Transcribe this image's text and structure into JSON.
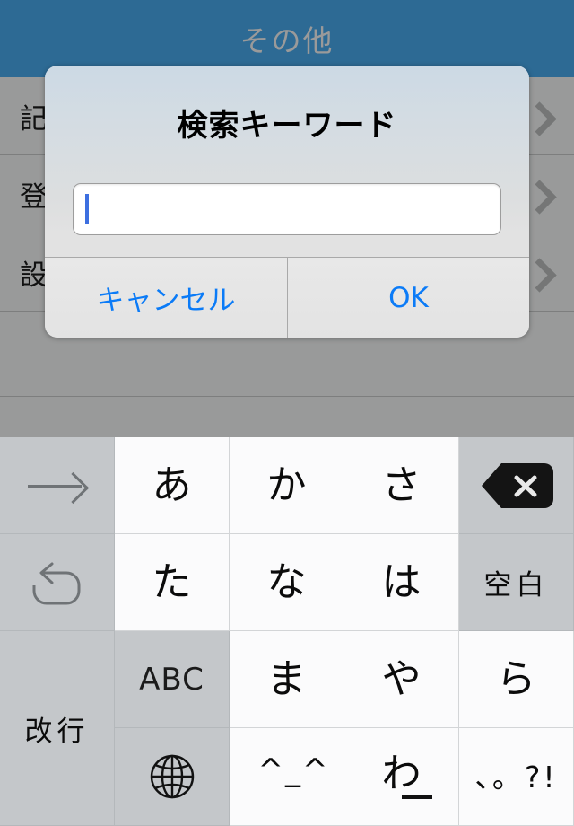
{
  "navbar": {
    "title": "その他"
  },
  "background_list": {
    "rows": [
      {
        "label": "記事検索",
        "accessory": "chevron-right-icon"
      },
      {
        "label": "登録",
        "accessory": "chevron-right-icon"
      },
      {
        "label": "設定",
        "accessory": "chevron-right-icon"
      }
    ]
  },
  "dialog": {
    "title": "検索キーワード",
    "input": {
      "value": "",
      "placeholder": ""
    },
    "buttons": [
      {
        "name": "cancel",
        "label": "キャンセル"
      },
      {
        "name": "ok",
        "label": "OK"
      }
    ],
    "accent_color": "#0b7bf7",
    "caret_color": "#3d6fe0"
  },
  "keyboard": {
    "type": "japanese-kana-10key",
    "rows": [
      [
        {
          "label": "→",
          "icon": "arrow-right-icon",
          "style": "gray-icon"
        },
        {
          "label": "あ",
          "style": "white"
        },
        {
          "label": "か",
          "style": "white"
        },
        {
          "label": "さ",
          "style": "white"
        },
        {
          "label": "",
          "icon": "delete-backspace-icon",
          "style": "gray-icon"
        }
      ],
      [
        {
          "label": "",
          "icon": "undo-icon",
          "style": "gray-icon"
        },
        {
          "label": "た",
          "style": "white"
        },
        {
          "label": "な",
          "style": "white"
        },
        {
          "label": "は",
          "style": "white"
        },
        {
          "label": "空白",
          "style": "gray"
        }
      ],
      [
        {
          "label": "ABC",
          "style": "gray"
        },
        {
          "label": "ま",
          "style": "white"
        },
        {
          "label": "や",
          "style": "white"
        },
        {
          "label": "ら",
          "style": "white"
        },
        {
          "label": "改行",
          "style": "gray",
          "rowspan": 2
        }
      ],
      [
        {
          "label": "",
          "icon": "globe-icon",
          "style": "gray-icon"
        },
        {
          "label": "^_^",
          "style": "white"
        },
        {
          "label": "わ",
          "style": "white"
        },
        {
          "label": "、。?!",
          "style": "white"
        }
      ]
    ]
  }
}
